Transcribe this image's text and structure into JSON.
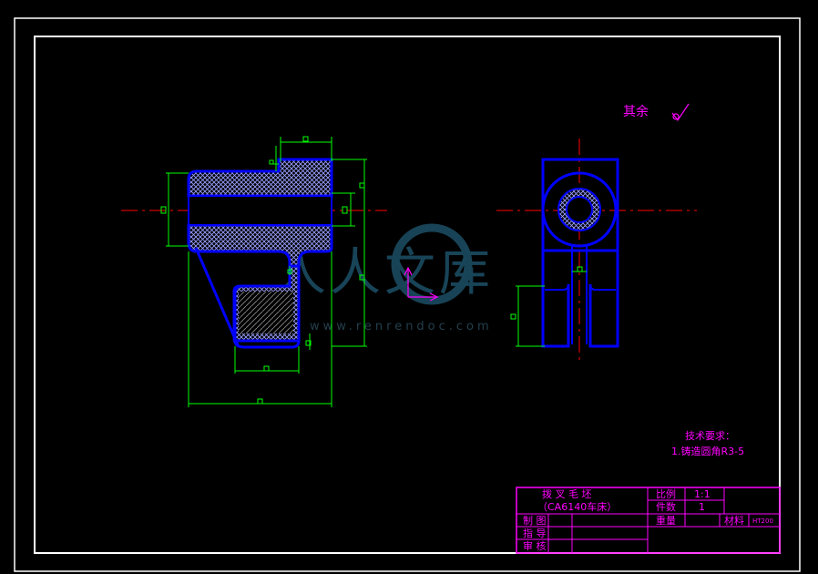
{
  "drawing": {
    "surface_note": "其余",
    "surface_mark": "6.3",
    "tech_req_title": "技术要求：",
    "tech_req_item": "1.铸造圆角R3-5",
    "dim_placeholder": "□"
  },
  "watermark": {
    "chars": "人人文库",
    "url": "www.renrendoc.com"
  },
  "title_block": {
    "part_name": "拨 叉 毛 坯",
    "machine": "（CA6140车床）",
    "scale_label": "比例",
    "scale_value": "1:1",
    "qty_label": "件数",
    "qty_value": "1",
    "weight_label": "重量",
    "material_label": "材料",
    "material_value": "HT200",
    "draw_label": "制   图",
    "guide_label": "指   导",
    "review_label": "审   核"
  },
  "colors": {
    "frame": "#ffffff",
    "outline": "#0000ff",
    "dimension": "#00ff00",
    "centerline": "#ff0000",
    "text": "#ff00ff",
    "hatch": "#8080ff",
    "watermark": "#1d4f66"
  }
}
